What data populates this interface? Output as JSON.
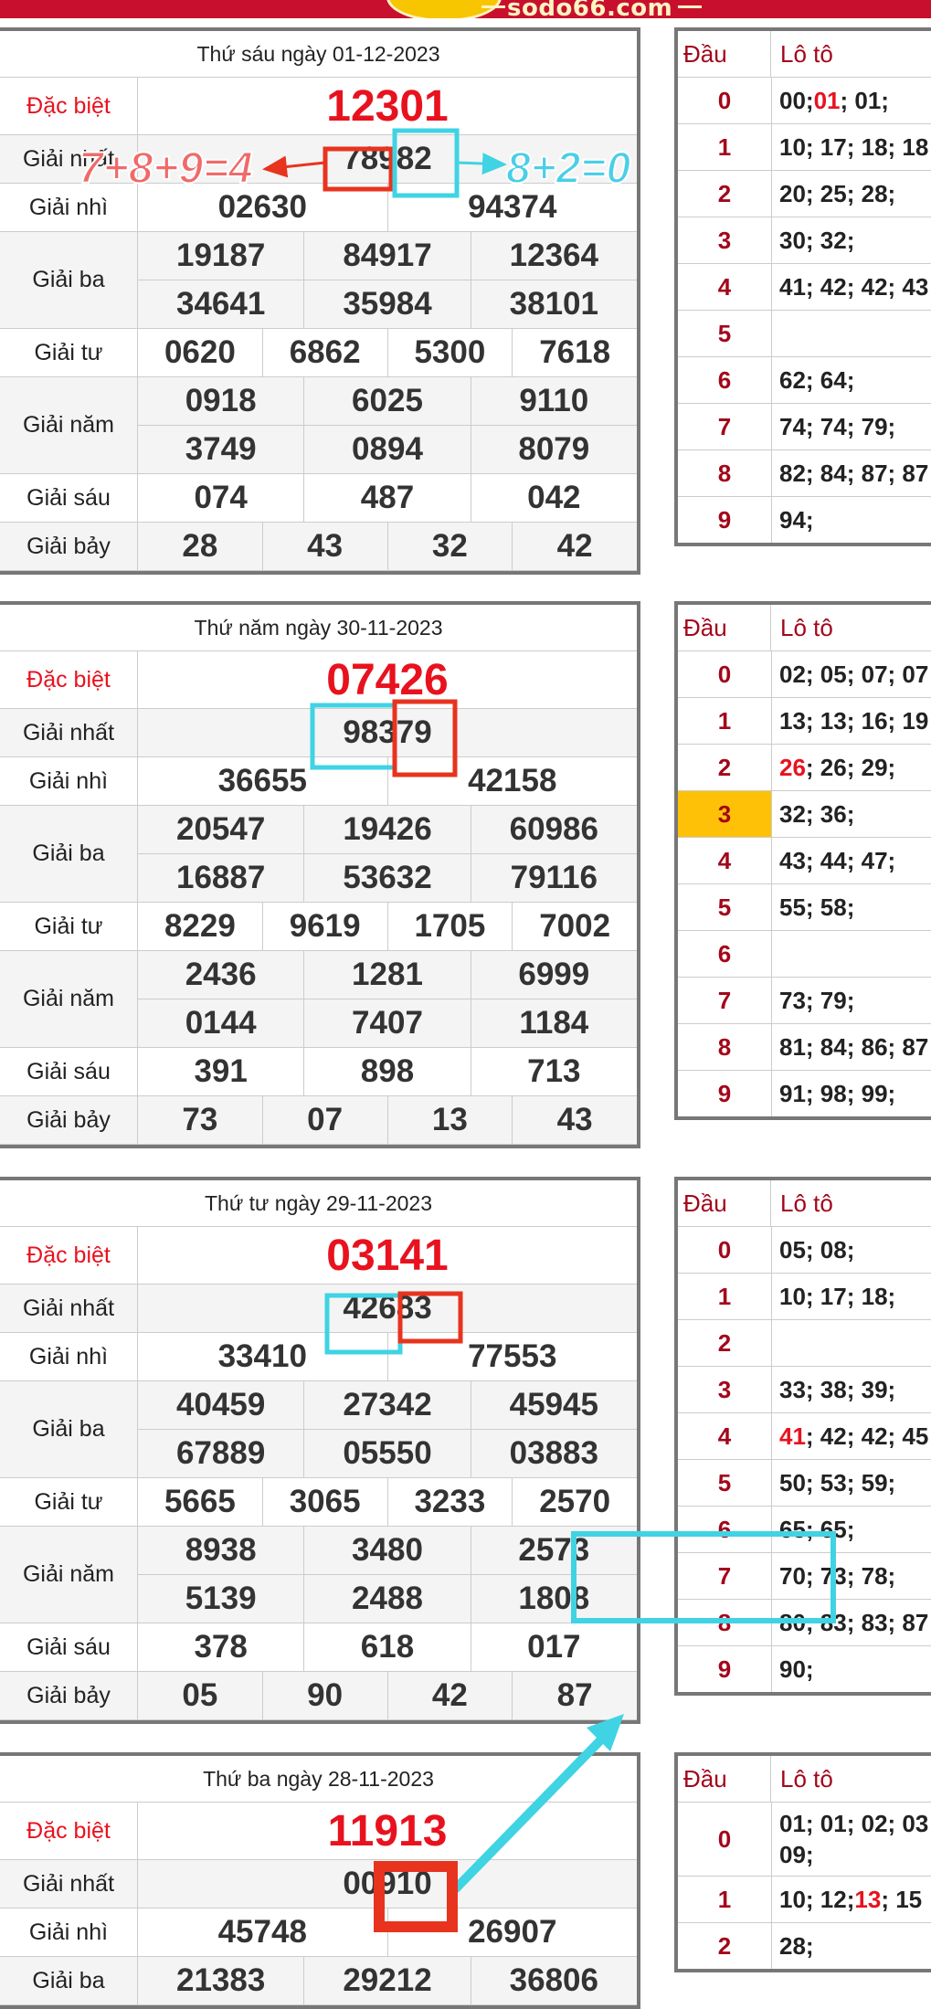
{
  "site": {
    "logo": "sodo66.com"
  },
  "loto_header": {
    "dau": "Đầu",
    "loto": "Lô tô"
  },
  "annotations": {
    "left_formula": "7+8+9=4",
    "right_formula": "8+2=0"
  },
  "colors": {
    "red": "#e8121e",
    "cyan": "#3fd3e3",
    "annotation_red": "#e8331e",
    "header_red": "#c8102e",
    "highlight": "#ffc107"
  },
  "draws": [
    {
      "date": "Thứ sáu ngày 01-12-2023",
      "prizes": [
        {
          "label": "Đặc biệt",
          "red": true,
          "rows": [
            [
              "12301"
            ]
          ]
        },
        {
          "label": "Giải nhất",
          "rows": [
            [
              "78982"
            ]
          ]
        },
        {
          "label": "Giải nhì",
          "rows": [
            [
              "02630",
              "94374"
            ]
          ]
        },
        {
          "label": "Giải ba",
          "rows": [
            [
              "19187",
              "84917",
              "12364"
            ],
            [
              "34641",
              "35984",
              "38101"
            ]
          ]
        },
        {
          "label": "Giải tư",
          "rows": [
            [
              "0620",
              "6862",
              "5300",
              "7618"
            ]
          ]
        },
        {
          "label": "Giải năm",
          "rows": [
            [
              "0918",
              "6025",
              "9110"
            ],
            [
              "3749",
              "0894",
              "8079"
            ]
          ]
        },
        {
          "label": "Giải sáu",
          "rows": [
            [
              "074",
              "487",
              "042"
            ]
          ]
        },
        {
          "label": "Giải bảy",
          "rows": [
            [
              "28",
              "43",
              "32",
              "42"
            ]
          ]
        }
      ],
      "loto": [
        {
          "dau": "0",
          "parts": [
            [
              "00; ",
              0
            ],
            [
              "01",
              1
            ],
            [
              "; 01;",
              0
            ]
          ]
        },
        {
          "dau": "1",
          "parts": [
            [
              "10; 17; 18; 18",
              0
            ]
          ]
        },
        {
          "dau": "2",
          "parts": [
            [
              "20; 25; 28;",
              0
            ]
          ]
        },
        {
          "dau": "3",
          "parts": [
            [
              "30; 32;",
              0
            ]
          ]
        },
        {
          "dau": "4",
          "parts": [
            [
              "41; 42; 42; 43",
              0
            ]
          ]
        },
        {
          "dau": "5",
          "parts": []
        },
        {
          "dau": "6",
          "parts": [
            [
              "62; 64;",
              0
            ]
          ]
        },
        {
          "dau": "7",
          "parts": [
            [
              "74; 74; 79;",
              0
            ]
          ]
        },
        {
          "dau": "8",
          "parts": [
            [
              "82; 84; 87; 87",
              0
            ]
          ]
        },
        {
          "dau": "9",
          "parts": [
            [
              "94;",
              0
            ]
          ]
        }
      ]
    },
    {
      "date": "Thứ năm ngày 30-11-2023",
      "prizes": [
        {
          "label": "Đặc biệt",
          "red": true,
          "rows": [
            [
              "07426"
            ]
          ]
        },
        {
          "label": "Giải nhất",
          "rows": [
            [
              "98379"
            ]
          ]
        },
        {
          "label": "Giải nhì",
          "rows": [
            [
              "36655",
              "42158"
            ]
          ]
        },
        {
          "label": "Giải ba",
          "rows": [
            [
              "20547",
              "19426",
              "60986"
            ],
            [
              "16887",
              "53632",
              "79116"
            ]
          ]
        },
        {
          "label": "Giải tư",
          "rows": [
            [
              "8229",
              "9619",
              "1705",
              "7002"
            ]
          ]
        },
        {
          "label": "Giải năm",
          "rows": [
            [
              "2436",
              "1281",
              "6999"
            ],
            [
              "0144",
              "7407",
              "1184"
            ]
          ]
        },
        {
          "label": "Giải sáu",
          "rows": [
            [
              "391",
              "898",
              "713"
            ]
          ]
        },
        {
          "label": "Giải bảy",
          "rows": [
            [
              "73",
              "07",
              "13",
              "43"
            ]
          ]
        }
      ],
      "loto": [
        {
          "dau": "0",
          "parts": [
            [
              "02; 05; 07; 07",
              0
            ]
          ]
        },
        {
          "dau": "1",
          "parts": [
            [
              "13; 13; 16; 19",
              0
            ]
          ]
        },
        {
          "dau": "2",
          "parts": [
            [
              "26",
              1
            ],
            [
              "; 26; 29;",
              0
            ]
          ]
        },
        {
          "dau": "3",
          "highlight": true,
          "parts": [
            [
              "32; 36;",
              0
            ]
          ]
        },
        {
          "dau": "4",
          "parts": [
            [
              "43; 44; 47;",
              0
            ]
          ]
        },
        {
          "dau": "5",
          "parts": [
            [
              "55; 58;",
              0
            ]
          ]
        },
        {
          "dau": "6",
          "parts": []
        },
        {
          "dau": "7",
          "parts": [
            [
              "73; 79;",
              0
            ]
          ]
        },
        {
          "dau": "8",
          "parts": [
            [
              "81; 84; 86; 87",
              0
            ]
          ]
        },
        {
          "dau": "9",
          "parts": [
            [
              "91; 98; 99;",
              0
            ]
          ]
        }
      ]
    },
    {
      "date": "Thứ tư ngày 29-11-2023",
      "prizes": [
        {
          "label": "Đặc biệt",
          "red": true,
          "rows": [
            [
              "03141"
            ]
          ]
        },
        {
          "label": "Giải nhất",
          "rows": [
            [
              "42683"
            ]
          ]
        },
        {
          "label": "Giải nhì",
          "rows": [
            [
              "33410",
              "77553"
            ]
          ]
        },
        {
          "label": "Giải ba",
          "rows": [
            [
              "40459",
              "27342",
              "45945"
            ],
            [
              "67889",
              "05550",
              "03883"
            ]
          ]
        },
        {
          "label": "Giải tư",
          "rows": [
            [
              "5665",
              "3065",
              "3233",
              "2570"
            ]
          ]
        },
        {
          "label": "Giải năm",
          "rows": [
            [
              "8938",
              "3480",
              "2573"
            ],
            [
              "5139",
              "2488",
              "1808"
            ]
          ]
        },
        {
          "label": "Giải sáu",
          "rows": [
            [
              "378",
              "618",
              "017"
            ]
          ]
        },
        {
          "label": "Giải bảy",
          "rows": [
            [
              "05",
              "90",
              "42",
              "87"
            ]
          ]
        }
      ],
      "loto": [
        {
          "dau": "0",
          "parts": [
            [
              "05; 08;",
              0
            ]
          ]
        },
        {
          "dau": "1",
          "parts": [
            [
              "10; 17; 18;",
              0
            ]
          ]
        },
        {
          "dau": "2",
          "parts": []
        },
        {
          "dau": "3",
          "parts": [
            [
              "33; 38; 39;",
              0
            ]
          ]
        },
        {
          "dau": "4",
          "parts": [
            [
              "41",
              1
            ],
            [
              "; 42; 42; 45",
              0
            ]
          ]
        },
        {
          "dau": "5",
          "parts": [
            [
              "50; 53; 59;",
              0
            ]
          ]
        },
        {
          "dau": "6",
          "parts": [
            [
              "65; 65;",
              0
            ]
          ]
        },
        {
          "dau": "7",
          "parts": [
            [
              "70; 73; 78;",
              0
            ]
          ]
        },
        {
          "dau": "8",
          "parts": [
            [
              "80; 83; 83; 87",
              0
            ]
          ]
        },
        {
          "dau": "9",
          "parts": [
            [
              "90;",
              0
            ]
          ]
        }
      ]
    },
    {
      "date": "Thứ ba ngày 28-11-2023",
      "prizes": [
        {
          "label": "Đặc biệt",
          "red": true,
          "rows": [
            [
              "11913"
            ]
          ]
        },
        {
          "label": "Giải nhất",
          "rows": [
            [
              "00910"
            ]
          ]
        },
        {
          "label": "Giải nhì",
          "rows": [
            [
              "45748",
              "26907"
            ]
          ]
        },
        {
          "label": "Giải ba",
          "rows": [
            [
              "21383",
              "29212",
              "36806"
            ]
          ]
        }
      ],
      "loto": [
        {
          "dau": "0",
          "tall": true,
          "parts": [
            [
              "01; 01; 02; 03 09;",
              0
            ]
          ]
        },
        {
          "dau": "1",
          "parts": [
            [
              "10; 12; ",
              0
            ],
            [
              "13",
              1
            ],
            [
              "; 15",
              0
            ]
          ]
        },
        {
          "dau": "2",
          "parts": [
            [
              "28;",
              0
            ]
          ]
        }
      ]
    }
  ]
}
